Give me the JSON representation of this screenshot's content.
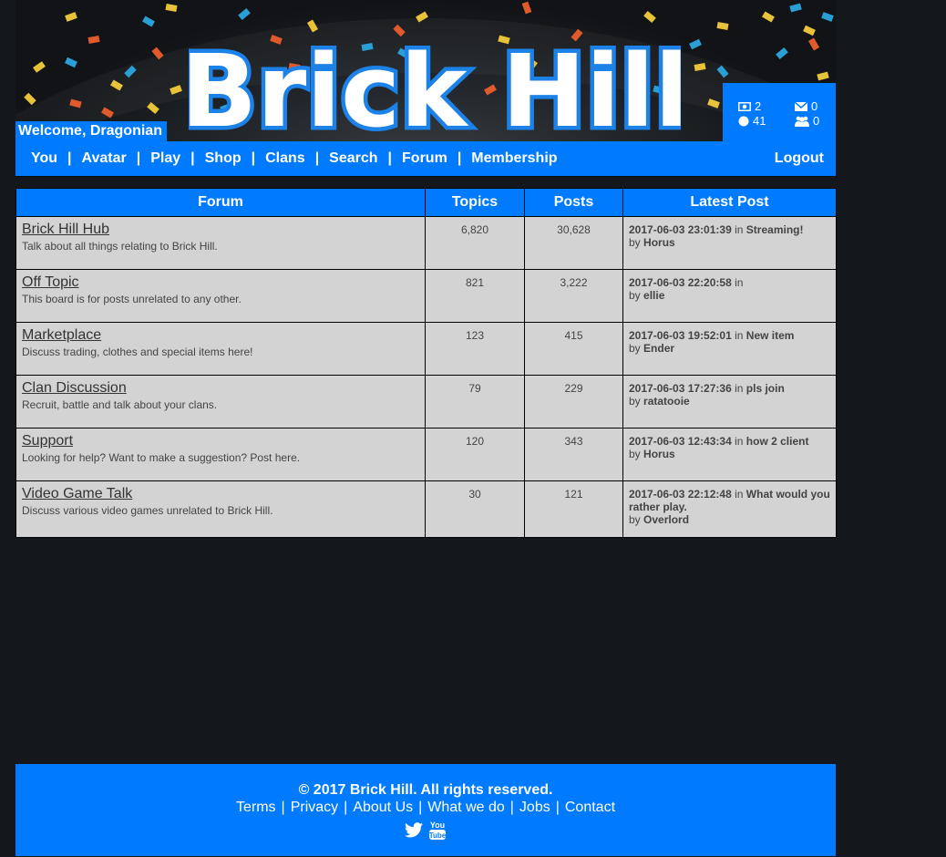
{
  "site": {
    "logo_text": "Brick Hill",
    "welcome": "Welcome, Dragonian",
    "accent_color": "#007bff"
  },
  "stats": {
    "bucks": "2",
    "bits": "41",
    "messages": "0",
    "friend_requests": "0"
  },
  "nav": {
    "links": [
      "You",
      "Avatar",
      "Play",
      "Shop",
      "Clans",
      "Search",
      "Forum",
      "Membership"
    ],
    "logout": "Logout"
  },
  "table": {
    "headers": [
      "Forum",
      "Topics",
      "Posts",
      "Latest Post"
    ],
    "by_label": "by",
    "in_label": "in",
    "rows": [
      {
        "name": "Brick Hill Hub",
        "desc": "Talk about all things relating to Brick Hill.",
        "topics": "6,820",
        "posts": "30,628",
        "date": "2017-06-03 23:01:39",
        "thread": "Streaming!",
        "author": "Horus"
      },
      {
        "name": "Off Topic",
        "desc": "This board is for posts unrelated to any other.",
        "topics": "821",
        "posts": "3,222",
        "date": "2017-06-03 22:20:58",
        "thread": "",
        "author": "ellie"
      },
      {
        "name": "Marketplace",
        "desc": "Discuss trading, clothes and special items here!",
        "topics": "123",
        "posts": "415",
        "date": "2017-06-03 19:52:01",
        "thread": "New item",
        "author": "Ender"
      },
      {
        "name": "Clan Discussion",
        "desc": "Recruit, battle and talk about your clans.",
        "topics": "79",
        "posts": "229",
        "date": "2017-06-03 17:27:36",
        "thread": "pls join",
        "author": "ratatooie"
      },
      {
        "name": "Support",
        "desc": "Looking for help? Want to make a suggestion? Post here.",
        "topics": "120",
        "posts": "343",
        "date": "2017-06-03 12:43:34",
        "thread": "how 2 client",
        "author": "Horus"
      },
      {
        "name": "Video Game Talk",
        "desc": "Discuss various video games unrelated to Brick Hill.",
        "topics": "30",
        "posts": "121",
        "date": "2017-06-03 22:12:48",
        "thread": "What would you rather play.",
        "author": "Overlord"
      }
    ]
  },
  "footer": {
    "copyright": "© 2017 Brick Hill. All rights reserved.",
    "links": [
      "Terms",
      "Privacy",
      "About Us",
      "What we do",
      "Jobs",
      "Contact"
    ],
    "icons": [
      "twitter-icon",
      "youtube-icon"
    ],
    "youtube_text": "You Tube"
  }
}
